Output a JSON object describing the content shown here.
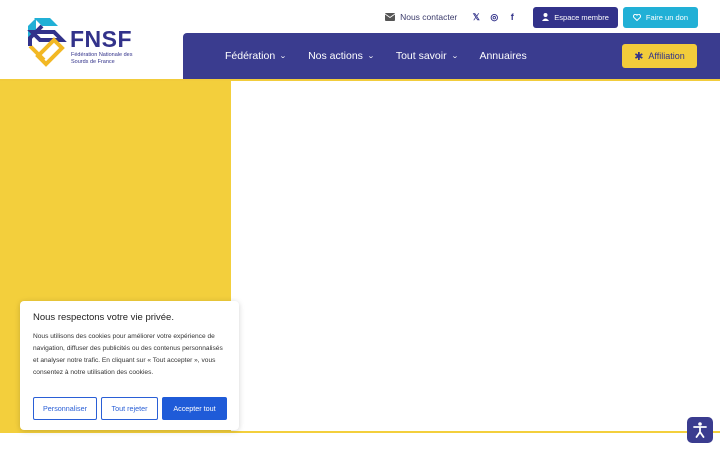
{
  "brand": {
    "name": "FNSF",
    "subtitle": "Fédération Nationale des Sourds de France"
  },
  "topbar": {
    "contact_label": "Nous contacter",
    "social": [
      {
        "icon": "x-twitter-icon",
        "glyph": "𝕏"
      },
      {
        "icon": "instagram-icon",
        "glyph": "◎"
      },
      {
        "icon": "facebook-icon",
        "glyph": "f"
      }
    ],
    "member_label": "Espace membre",
    "donate_label": "Faire un don"
  },
  "nav": {
    "items": [
      {
        "label": "Fédération",
        "has_dropdown": true
      },
      {
        "label": "Nos actions",
        "has_dropdown": true
      },
      {
        "label": "Tout savoir",
        "has_dropdown": true
      },
      {
        "label": "Annuaires",
        "has_dropdown": false
      }
    ],
    "chevron": "⌄",
    "affiliation_label": "Affiliation",
    "affiliation_glyph": "✱"
  },
  "cookie": {
    "title": "Nous respectons votre vie privée.",
    "text": "Nous utilisons des cookies pour améliorer votre expérience de navigation, diffuser des publicités ou des contenus personnalisés et analyser notre trafic. En cliquant sur « Tout accepter », vous consentez à notre utilisation des cookies.",
    "customize_label": "Personnaliser",
    "reject_label": "Tout rejeter",
    "accept_label": "Accepter tout"
  },
  "colors": {
    "navy": "#3a3c8f",
    "yellow": "#f3cf3c",
    "cyan": "#21b0d6",
    "blue": "#1f5bd8"
  }
}
